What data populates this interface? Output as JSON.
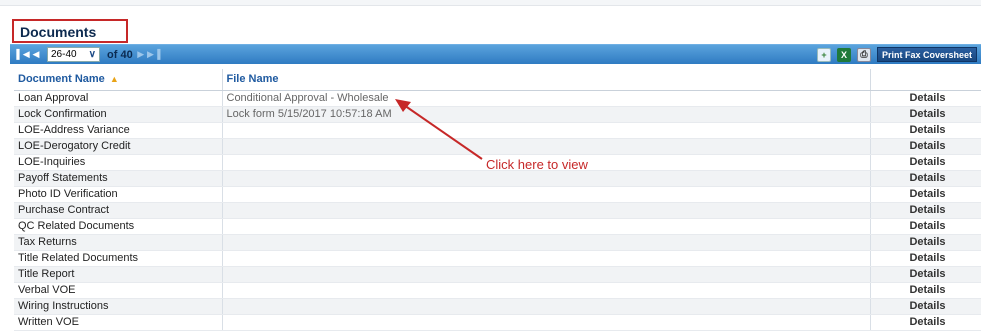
{
  "panel": {
    "title": "Documents"
  },
  "toolbar": {
    "page_range": "26-40",
    "of_prefix": "of",
    "total": "40",
    "fax_button": "Print Fax Coversheet",
    "icons": [
      "add-document-icon",
      "excel-export-icon",
      "print-icon"
    ]
  },
  "table": {
    "columns": {
      "doc": "Document Name",
      "file": "File Name",
      "actions": ""
    },
    "sort_indicator": "▲",
    "rows": [
      {
        "doc": "Loan Approval",
        "file": "Conditional Approval - Wholesale",
        "action": "Details"
      },
      {
        "doc": "Lock Confirmation",
        "file": "Lock form 5/15/2017 10:57:18 AM",
        "action": "Details"
      },
      {
        "doc": "LOE-Address Variance",
        "file": "",
        "action": "Details"
      },
      {
        "doc": "LOE-Derogatory Credit",
        "file": "",
        "action": "Details"
      },
      {
        "doc": "LOE-Inquiries",
        "file": "",
        "action": "Details"
      },
      {
        "doc": "Payoff Statements",
        "file": "",
        "action": "Details"
      },
      {
        "doc": "Photo ID Verification",
        "file": "",
        "action": "Details"
      },
      {
        "doc": "Purchase Contract",
        "file": "",
        "action": "Details"
      },
      {
        "doc": "QC Related Documents",
        "file": "",
        "action": "Details"
      },
      {
        "doc": "Tax Returns",
        "file": "",
        "action": "Details"
      },
      {
        "doc": "Title Related Documents",
        "file": "",
        "action": "Details"
      },
      {
        "doc": "Title Report",
        "file": "",
        "action": "Details"
      },
      {
        "doc": "Verbal VOE",
        "file": "",
        "action": "Details"
      },
      {
        "doc": "Wiring Instructions",
        "file": "",
        "action": "Details"
      },
      {
        "doc": "Written VOE",
        "file": "",
        "action": "Details"
      }
    ]
  },
  "annotation": {
    "text": "Click here to view",
    "color": "#c62828"
  },
  "colors": {
    "toolbar": "#2f7bc2",
    "header_text": "#1f5aa0",
    "sort_arrow": "#e8a317"
  }
}
